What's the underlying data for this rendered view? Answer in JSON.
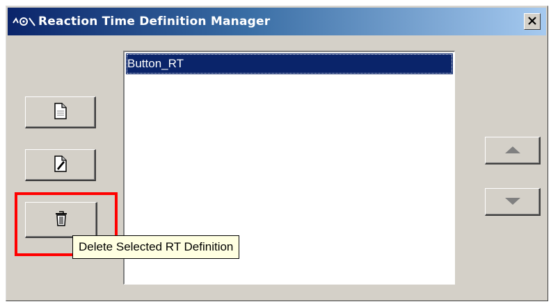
{
  "window": {
    "title": "Reaction Time Definition Manager",
    "title_icon": "waveform-icon",
    "close_icon": "close-icon"
  },
  "toolbar": {
    "new_icon": "new-document-icon",
    "edit_icon": "edit-document-icon",
    "delete_icon": "trash-icon"
  },
  "list": {
    "items": [
      {
        "label": "Button_RT",
        "selected": true
      }
    ]
  },
  "order_buttons": {
    "up_icon": "arrow-up-icon",
    "down_icon": "arrow-down-icon"
  },
  "tooltip": {
    "text": "Delete Selected RT Definition"
  },
  "colors": {
    "title_start": "#0a246a",
    "title_end": "#a6caf0",
    "selection": "#0a246a",
    "highlight": "#ff0000",
    "tooltip_bg": "#ffffe1",
    "face": "#d4d0c8"
  }
}
